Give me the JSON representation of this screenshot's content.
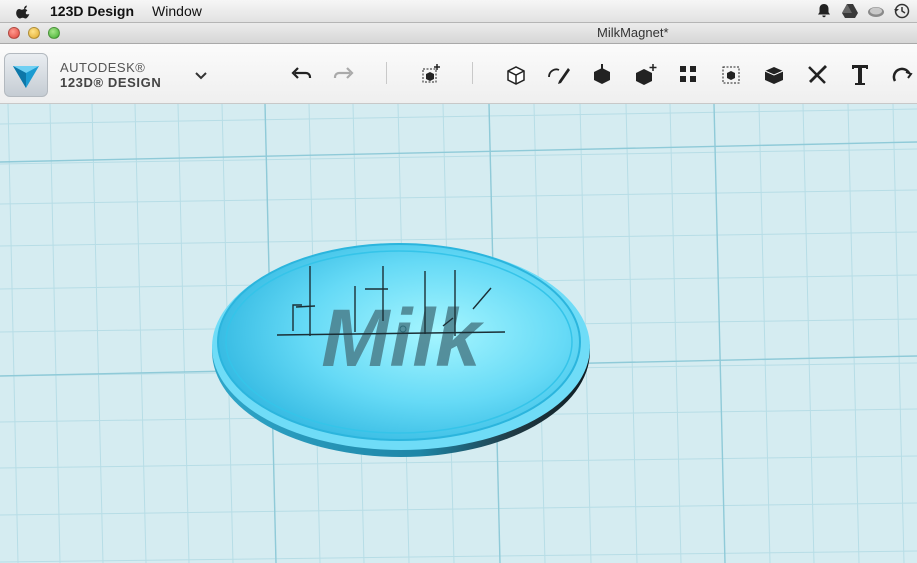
{
  "menubar": {
    "app_name": "123D Design",
    "menus": [
      "Window"
    ]
  },
  "window": {
    "title": "MilkMagnet*"
  },
  "brand": {
    "line1": "AUTODESK®",
    "line2": "123D® DESIGN"
  },
  "toolbar": {
    "tools": [
      "undo-icon",
      "redo-icon",
      "transform-icon",
      "primitives-icon",
      "sketch-icon",
      "construct-icon",
      "modify-icon",
      "pattern-icon",
      "grouping-icon",
      "combine-icon",
      "measure-icon",
      "text-icon",
      "snap-icon"
    ]
  },
  "model": {
    "text": "Milk"
  },
  "colors": {
    "viewport_bg": "#d4ecf0",
    "grid_line": "#a8d6e0",
    "model_fill": "#5fd4f3",
    "text_fill": "#4a7f8c"
  }
}
